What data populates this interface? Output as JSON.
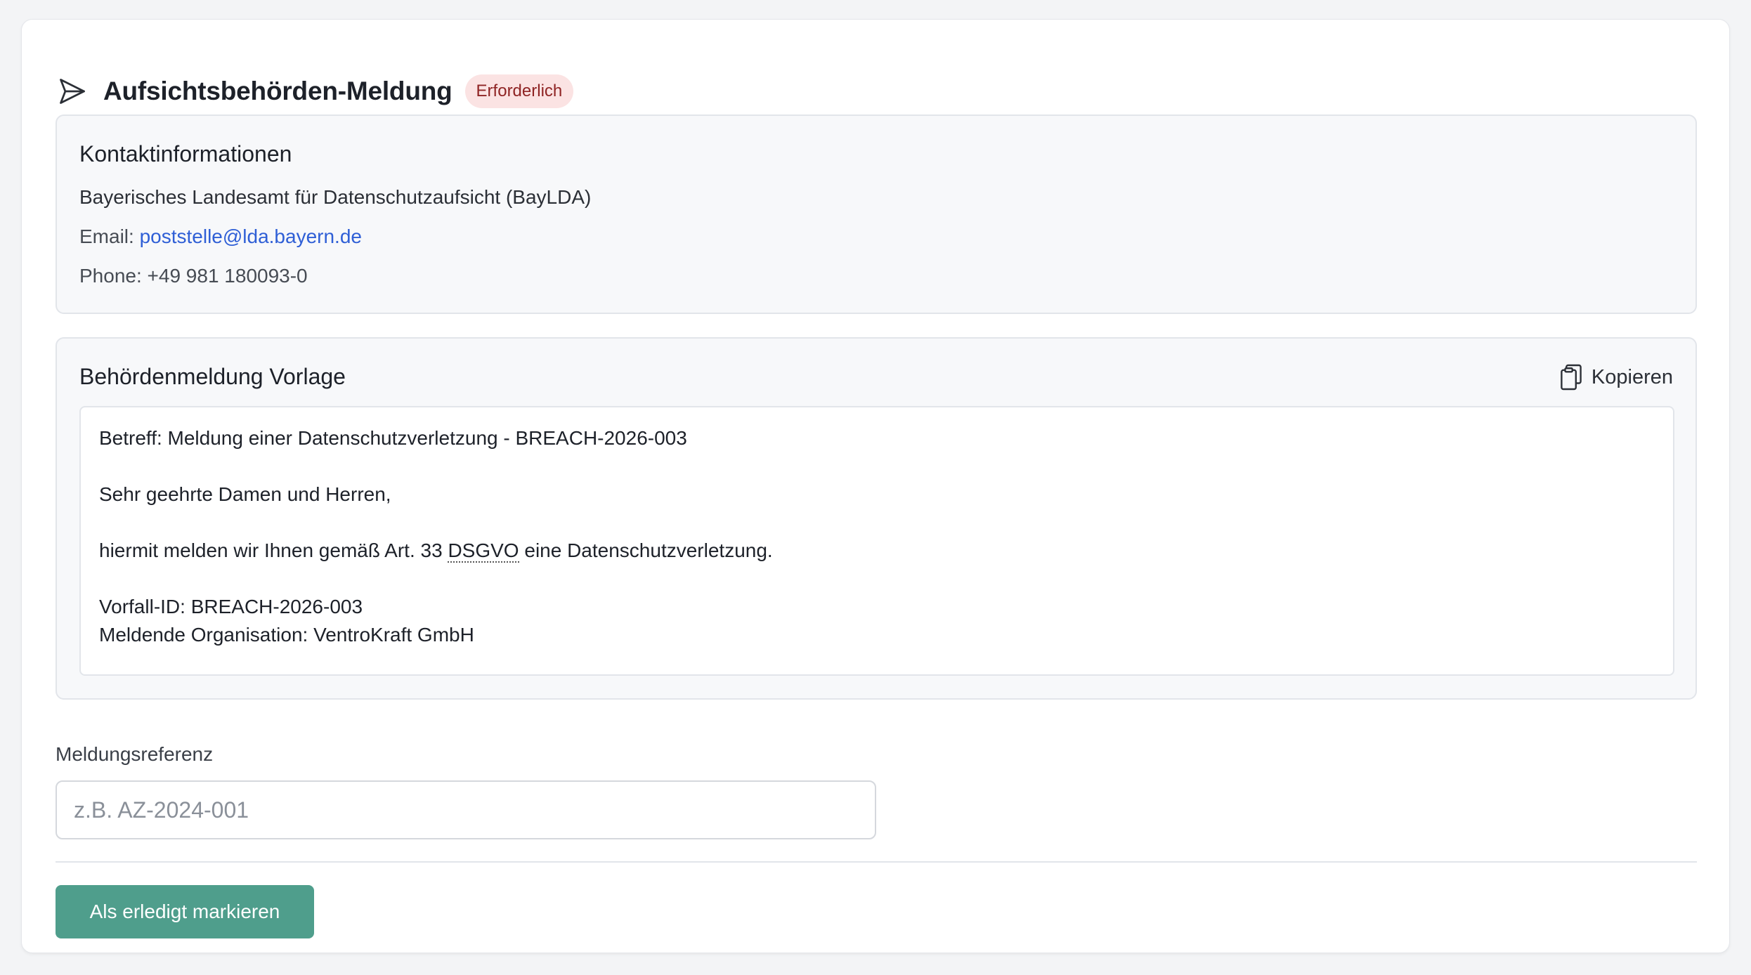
{
  "header": {
    "title": "Aufsichtsbehörden-Meldung",
    "badge": "Erforderlich",
    "icon": "send-icon"
  },
  "contact": {
    "heading": "Kontaktinformationen",
    "authority": "Bayerisches Landesamt für Datenschutzaufsicht (BayLDA)",
    "email_label": "Email:",
    "email": "poststelle@lda.bayern.de",
    "phone_label": "Phone:",
    "phone": "+49 981 180093-0"
  },
  "template": {
    "heading": "Behördenmeldung Vorlage",
    "copy_label": "Kopieren",
    "subject": "Betreff: Meldung einer Datenschutzverletzung - BREACH-2026-003",
    "greeting": "Sehr geehrte Damen und Herren,",
    "body_pre": "hiermit melden wir Ihnen gemäß Art. 33 ",
    "body_abbr": "DSGVO",
    "body_post": " eine Datenschutzverletzung.",
    "incident": "Vorfall-ID: BREACH-2026-003",
    "organisation": "Meldende Organisation: VentroKraft GmbH"
  },
  "reference": {
    "label": "Meldungsreferenz",
    "placeholder": "z.B. AZ-2024-001",
    "value": ""
  },
  "actions": {
    "done_label": "Als erledigt markieren"
  },
  "colors": {
    "accent": "#4f9e8c",
    "link": "#2f5fd6",
    "badge_bg": "#fbe3e3",
    "badge_text": "#8f2424"
  }
}
